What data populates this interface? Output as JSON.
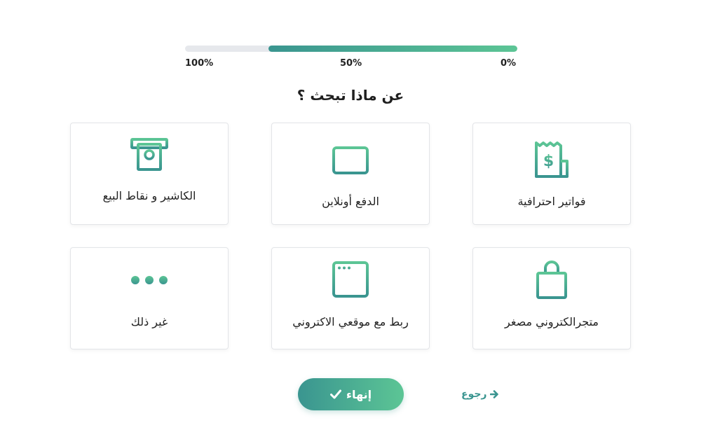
{
  "progress": {
    "value_percent": 75,
    "labels": {
      "start": "100%",
      "middle": "50%",
      "end": "0%"
    },
    "fill_colors": [
      "#3a9590",
      "#5cc595"
    ],
    "track_color": "#e6e8ec"
  },
  "question": {
    "title": "عن ماذا تبحث ؟"
  },
  "options": [
    {
      "label": "فواتير احترافية",
      "icon": "receipt-dollar-icon"
    },
    {
      "label": "الدفع أونلاين",
      "icon": "credit-card-icon"
    },
    {
      "label": "الكاشير و نقاط البيع",
      "icon": "cash-register-icon"
    },
    {
      "label": "متجرالكتروني مصغر",
      "icon": "shopping-bag-icon"
    },
    {
      "label": "ربط مع موقعي الاكتروني",
      "icon": "browser-window-icon"
    },
    {
      "label": "غير ذلك",
      "icon": "more-dots-icon"
    }
  ],
  "actions": {
    "finish_label": "إنهاء",
    "back_label": "رجوع"
  },
  "colors": {
    "accent": "#3a9590",
    "accent_light": "#5cc595"
  }
}
